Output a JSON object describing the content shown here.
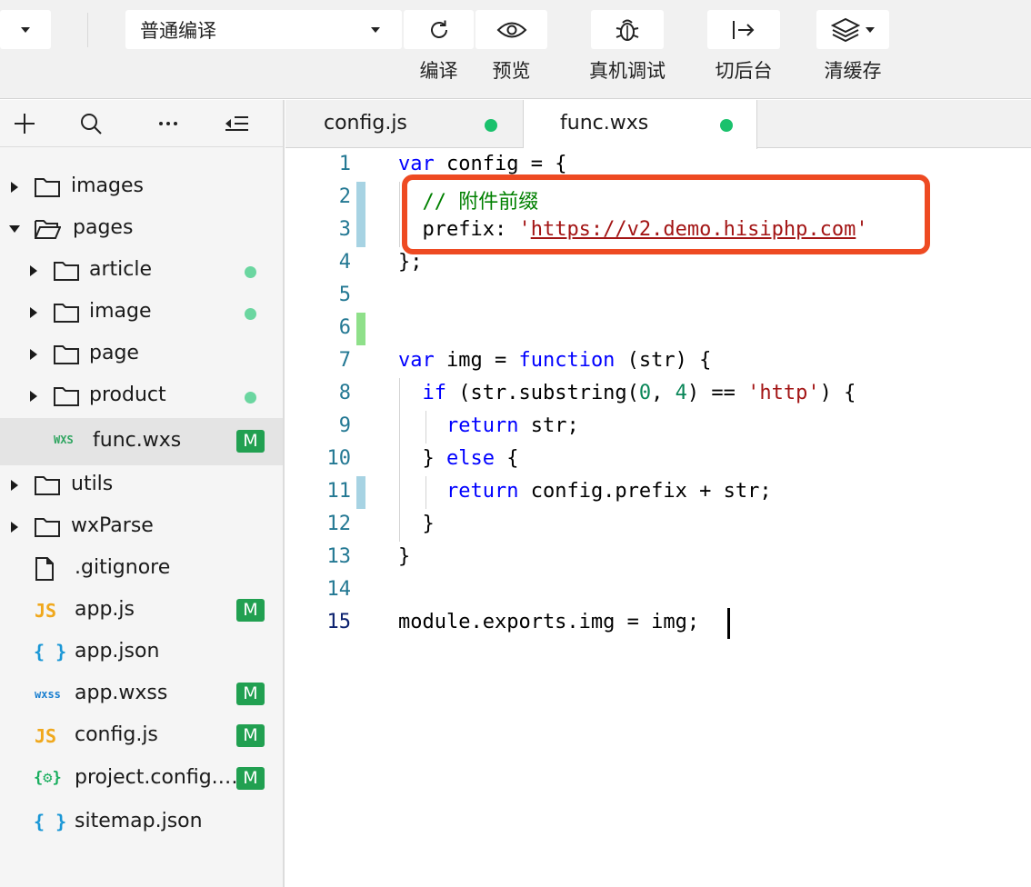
{
  "toolbar": {
    "compile_mode": "普通编译",
    "buttons": [
      {
        "label": "编译",
        "icon": "refresh-icon"
      },
      {
        "label": "预览",
        "icon": "eye-icon"
      },
      {
        "label": "真机调试",
        "icon": "bug-icon"
      },
      {
        "label": "切后台",
        "icon": "switch-background-icon"
      },
      {
        "label": "清缓存",
        "icon": "layers-icon"
      }
    ]
  },
  "explorer": {
    "actions": [
      "add-icon",
      "search-icon",
      "more-icon",
      "collapse-icon"
    ],
    "tree": [
      {
        "name": "images",
        "type": "folder"
      },
      {
        "name": "pages",
        "type": "folder",
        "expanded": true
      },
      {
        "name": "article",
        "type": "folder",
        "modified_dot": true
      },
      {
        "name": "image",
        "type": "folder",
        "modified_dot": true
      },
      {
        "name": "page",
        "type": "folder"
      },
      {
        "name": "product",
        "type": "folder",
        "modified_dot": true
      },
      {
        "name": "func.wxs",
        "type": "wxs",
        "icon_text": "WXS",
        "badge": "M",
        "selected": true
      },
      {
        "name": "utils",
        "type": "folder"
      },
      {
        "name": "wxParse",
        "type": "folder"
      },
      {
        "name": ".gitignore",
        "type": "file"
      },
      {
        "name": "app.js",
        "type": "js",
        "icon_text": "JS",
        "badge": "M"
      },
      {
        "name": "app.json",
        "type": "json",
        "icon_text": "{ }"
      },
      {
        "name": "app.wxss",
        "type": "wxss",
        "icon_text": "wxss",
        "badge": "M"
      },
      {
        "name": "config.js",
        "type": "js",
        "icon_text": "JS",
        "badge": "M"
      },
      {
        "name": "project.config.…",
        "type": "config",
        "icon_text": "{⚙}",
        "badge": "M"
      },
      {
        "name": "sitemap.json",
        "type": "json",
        "icon_text": "{ }"
      }
    ]
  },
  "tabs": [
    {
      "label": "config.js",
      "active": false
    },
    {
      "label": "func.wxs",
      "active": true
    }
  ],
  "editor": {
    "current_line": 15,
    "lines": [
      {
        "n": "1",
        "code": "var config = {"
      },
      {
        "n": "2",
        "code": "  // 附件前缀"
      },
      {
        "n": "3",
        "code": "  prefix: 'https://v2.demo.hisiphp.com'"
      },
      {
        "n": "4",
        "code": "};"
      },
      {
        "n": "5",
        "code": ""
      },
      {
        "n": "6",
        "code": ""
      },
      {
        "n": "7",
        "code": "var img = function (str) {"
      },
      {
        "n": "8",
        "code": "  if (str.substring(0, 4) == 'http') {"
      },
      {
        "n": "9",
        "code": "    return str;"
      },
      {
        "n": "10",
        "code": "  } else {"
      },
      {
        "n": "11",
        "code": "    return config.prefix + str;"
      },
      {
        "n": "12",
        "code": "  }"
      },
      {
        "n": "13",
        "code": "}"
      },
      {
        "n": "14",
        "code": ""
      },
      {
        "n": "15",
        "code": "module.exports.img = img;"
      }
    ]
  },
  "colors": {
    "keyword": "#0000ff",
    "comment": "#008000",
    "string": "#a31515",
    "number": "#098658",
    "line_number": "#237893",
    "highlight_box": "#ee4a22",
    "badge_modified": "#21a051",
    "tab_dot": "#1ac16c"
  }
}
